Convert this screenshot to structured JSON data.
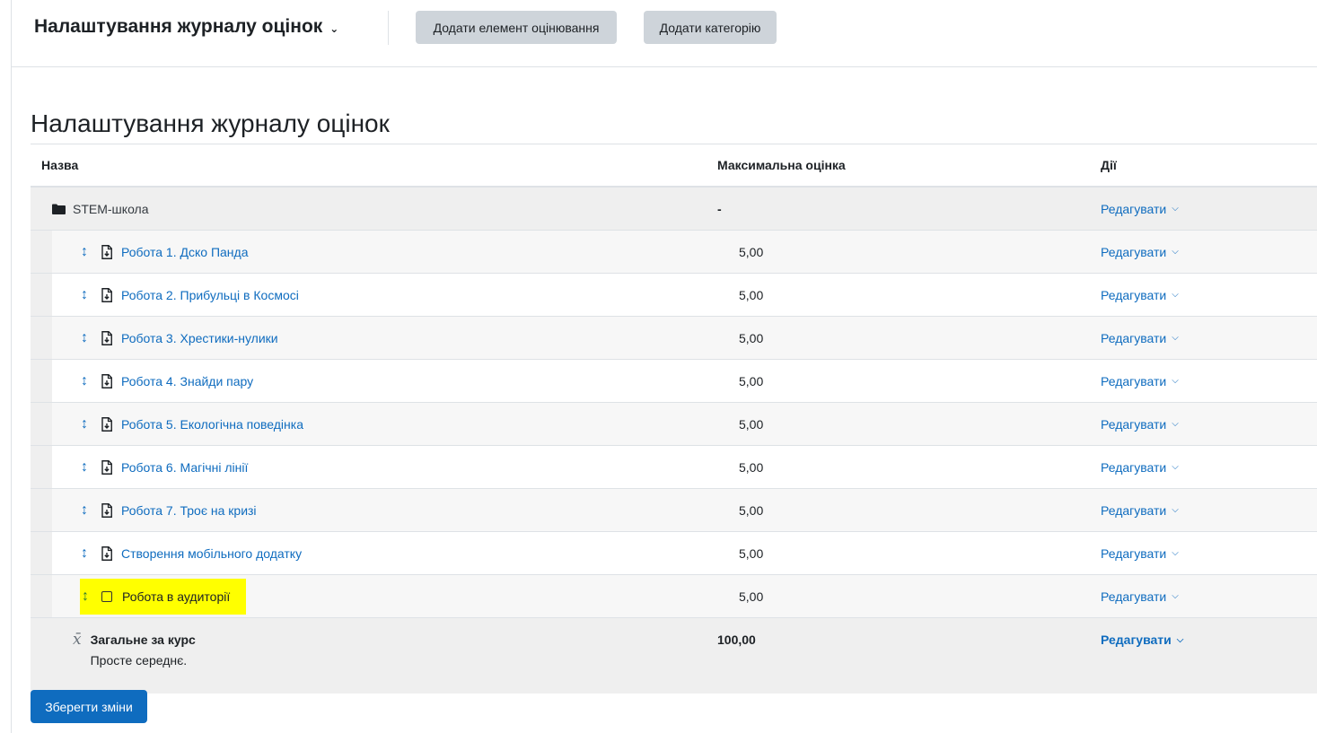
{
  "nav": {
    "title": "Налаштування журналу оцінок"
  },
  "toolbar": {
    "add_item": "Додати елемент оцінювання",
    "add_category": "Додати категорію"
  },
  "page_title": "Налаштування журналу оцінок",
  "columns": {
    "name": "Назва",
    "max": "Максимальна оцінка",
    "actions": "Дії"
  },
  "category": {
    "name": "STEM-школа",
    "max": "-",
    "edit": "Редагувати"
  },
  "items": [
    {
      "name": "Робота 1. Дско Панда",
      "max": "5,00",
      "edit": "Редагувати"
    },
    {
      "name": "Робота 2. Прибульці в Космосі",
      "max": "5,00",
      "edit": "Редагувати"
    },
    {
      "name": "Робота 3. Хрестики-нулики",
      "max": "5,00",
      "edit": "Редагувати"
    },
    {
      "name": "Робота 4. Знайди пару",
      "max": "5,00",
      "edit": "Редагувати"
    },
    {
      "name": "Робота 5. Екологічна поведінка",
      "max": "5,00",
      "edit": "Редагувати"
    },
    {
      "name": "Робота 6. Магічні лінії",
      "max": "5,00",
      "edit": "Редагувати"
    },
    {
      "name": "Робота 7. Троє на кризі",
      "max": "5,00",
      "edit": "Редагувати"
    },
    {
      "name": "Створення мобільного додатку",
      "max": "5,00",
      "edit": "Редагувати"
    },
    {
      "name": "Робота в аудиторії",
      "max": "5,00",
      "edit": "Редагувати"
    }
  ],
  "total": {
    "name": "Загальне за курс",
    "method": "Просте середнє.",
    "max": "100,00",
    "edit": "Редагувати",
    "icon": "x̄"
  },
  "save": "Зберегти зміни",
  "colors": {
    "link": "#0f6cbf",
    "highlight": "#ffff00",
    "primary": "#0f6cbf"
  }
}
